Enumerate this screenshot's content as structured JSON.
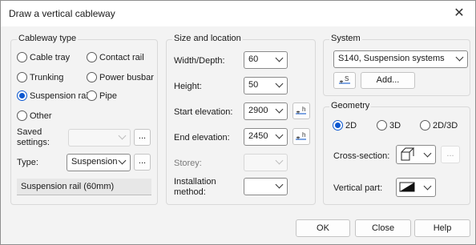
{
  "window": {
    "title": "Draw a vertical cableway",
    "close_glyph": "✕"
  },
  "cableway_type": {
    "title": "Cableway type",
    "options": [
      "Cable tray",
      "Contact rail",
      "Trunking",
      "Power busbar",
      "Suspension rail",
      "Pipe",
      "Other"
    ],
    "selected": "Suspension rail",
    "saved_settings_label": "Saved settings:",
    "saved_settings_value": "",
    "type_label": "Type:",
    "type_value": "Suspension",
    "more_label": "...",
    "info": "Suspension rail (60mm)"
  },
  "size_location": {
    "title": "Size and location",
    "width_label": "Width/Depth:",
    "width_value": "60",
    "height_label": "Height:",
    "height_value": "50",
    "start_label": "Start elevation:",
    "start_value": "2900",
    "end_label": "End elevation:",
    "end_value": "2450",
    "storey_label": "Storey:",
    "storey_value": "",
    "install_label": "Installation method:",
    "install_value": "",
    "elev_icon_letter": "h"
  },
  "system": {
    "title": "System",
    "value": "S140, Suspension systems",
    "icon_letter": "S",
    "add_label": "Add..."
  },
  "geometry": {
    "title": "Geometry",
    "options": [
      "2D",
      "3D",
      "2D/3D"
    ],
    "selected": "2D",
    "cross_section_label": "Cross-section:",
    "vertical_part_label": "Vertical part:",
    "more_label": "..."
  },
  "footer": {
    "ok": "OK",
    "close": "Close",
    "help": "Help"
  }
}
